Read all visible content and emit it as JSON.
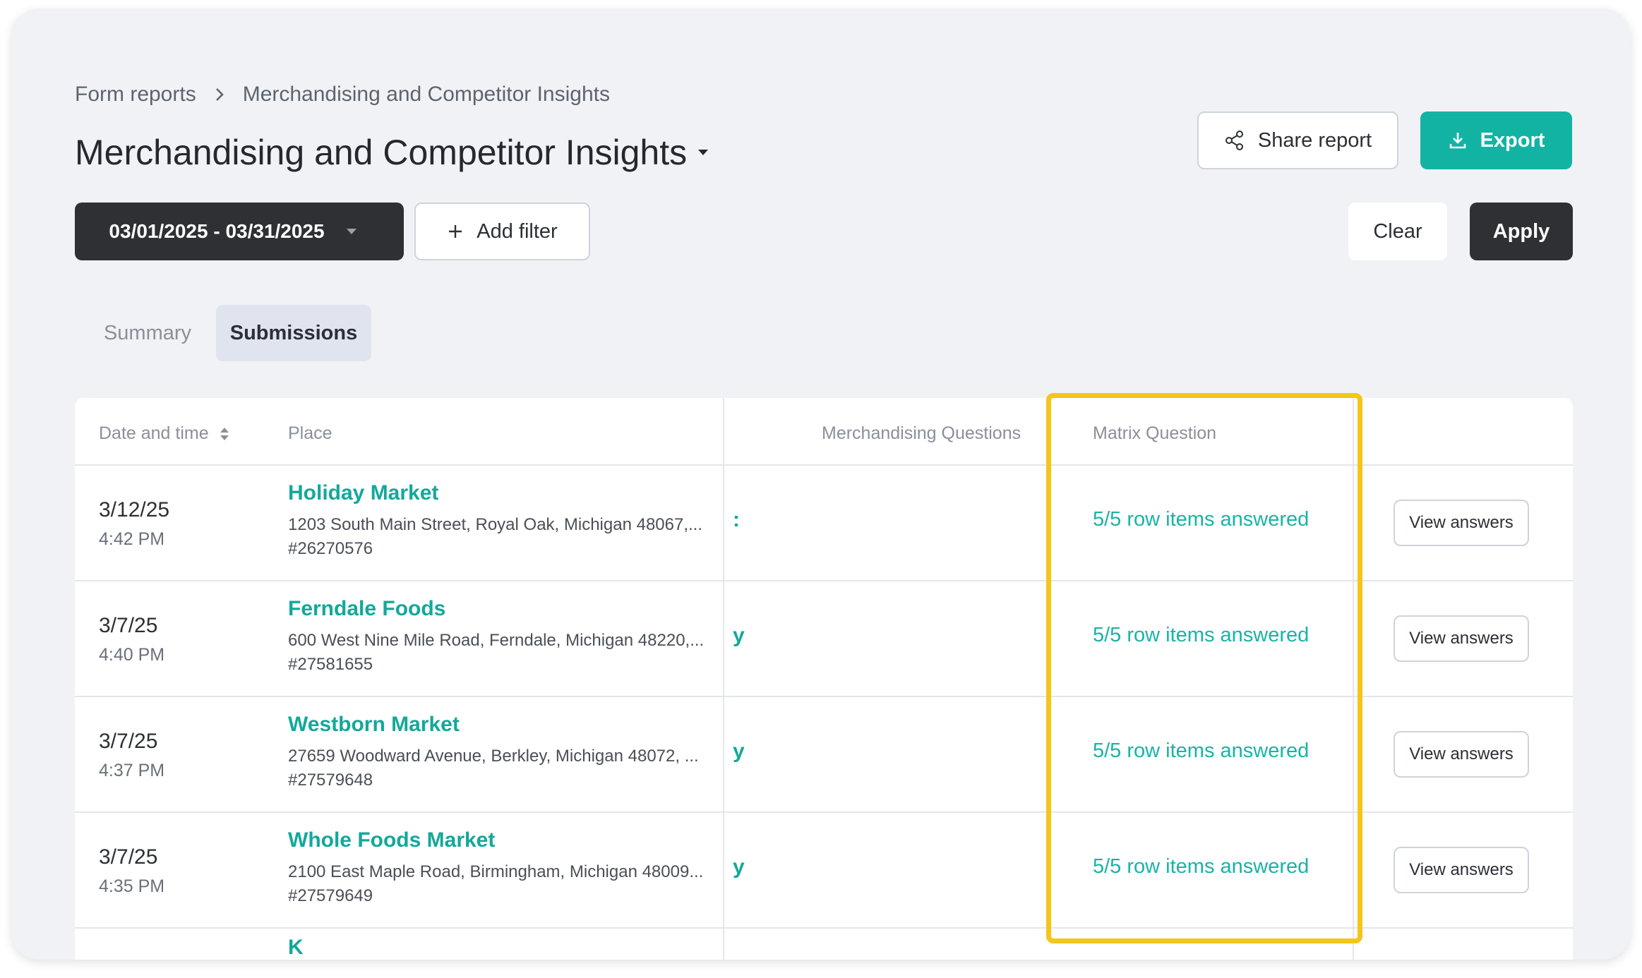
{
  "breadcrumb": {
    "parent": "Form reports",
    "current": "Merchandising and Competitor Insights"
  },
  "header": {
    "title": "Merchandising and Competitor Insights",
    "share_label": "Share report",
    "export_label": "Export"
  },
  "filters": {
    "date_range": "03/01/2025 - 03/31/2025",
    "add_filter_label": "Add filter",
    "clear_label": "Clear",
    "apply_label": "Apply"
  },
  "tabs": [
    {
      "label": "Summary",
      "active": false
    },
    {
      "label": "Submissions",
      "active": true
    }
  ],
  "table": {
    "columns": {
      "date": "Date and time",
      "place": "Place",
      "merch": "Merchandising Questions",
      "matrix": "Matrix Question"
    },
    "rows": [
      {
        "date": "3/12/25",
        "time": "4:42 PM",
        "place": "Holiday Market",
        "address": "1203 South Main Street, Royal Oak, Michigan 48067,...",
        "id": "#26270576",
        "merch_fragment": ":",
        "matrix": "5/5 row items answered",
        "action": "View answers"
      },
      {
        "date": "3/7/25",
        "time": "4:40 PM",
        "place": "Ferndale Foods",
        "address": "600 West Nine Mile Road, Ferndale, Michigan 48220,...",
        "id": "#27581655",
        "merch_fragment": "y",
        "matrix": "5/5 row items answered",
        "action": "View answers"
      },
      {
        "date": "3/7/25",
        "time": "4:37 PM",
        "place": "Westborn Market",
        "address": "27659 Woodward Avenue, Berkley, Michigan 48072, ...",
        "id": "#27579648",
        "merch_fragment": "y",
        "matrix": "5/5 row items answered",
        "action": "View answers"
      },
      {
        "date": "3/7/25",
        "time": "4:35 PM",
        "place": "Whole Foods Market",
        "address": "2100 East Maple Road, Birmingham, Michigan 48009...",
        "id": "#27579649",
        "merch_fragment": "y",
        "matrix": "5/5 row items answered",
        "action": "View answers"
      }
    ],
    "partial_row_text": "K"
  },
  "colors": {
    "accent": "#13b3a4",
    "highlight": "#f5c51a",
    "dark_button": "#2e3034"
  },
  "icons": {
    "share": "share-icon",
    "export": "download-icon",
    "add": "plus-icon",
    "sort": "sort-icon",
    "caret": "caret-down-icon",
    "chevron": "chevron-right-icon"
  }
}
